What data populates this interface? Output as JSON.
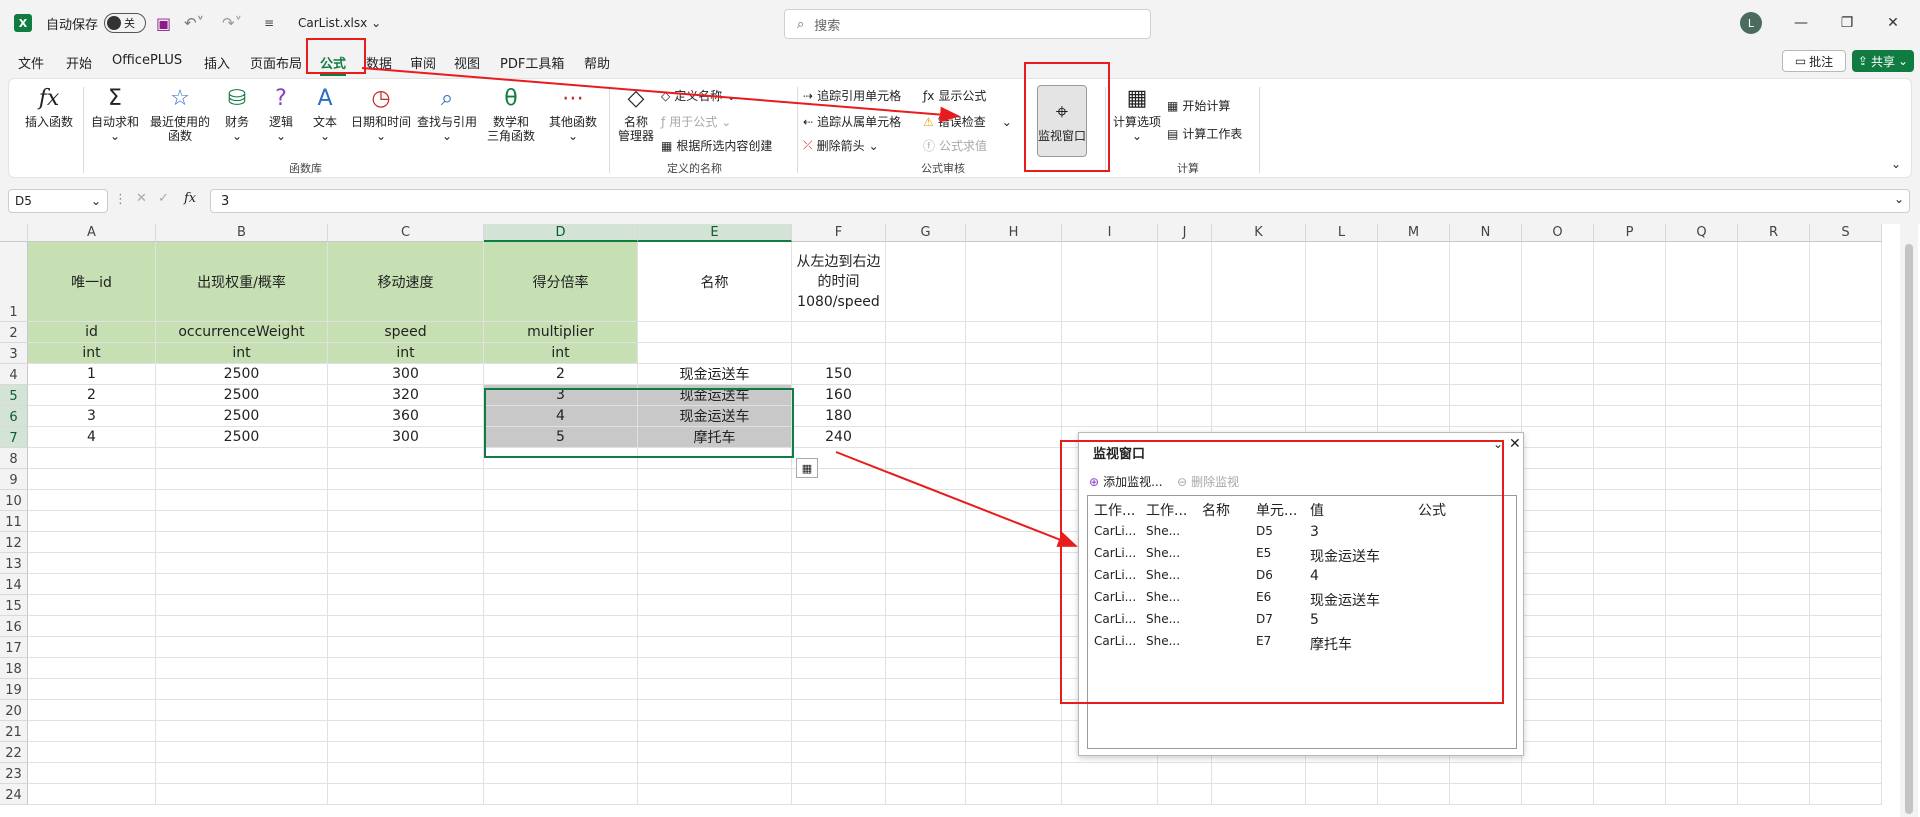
{
  "titlebar": {
    "app_icon": "X",
    "autosave_label": "自动保存",
    "autosave_state": "关",
    "filename": "CarList.xlsx",
    "search_placeholder": "搜索",
    "avatar_initial": "L"
  },
  "tabs": [
    "文件",
    "开始",
    "OfficePLUS",
    "插入",
    "页面布局",
    "公式",
    "数据",
    "审阅",
    "视图",
    "PDF工具箱",
    "帮助"
  ],
  "active_tab": "公式",
  "top_right": {
    "comments": "批注",
    "share": "共享"
  },
  "ribbon": {
    "function_library": {
      "label": "函数库",
      "buttons": [
        "插入函数",
        "自动求和",
        "最近使用的\n函数",
        "财务",
        "逻辑",
        "文本",
        "日期和时间",
        "查找与引用",
        "数学和\n三角函数",
        "其他函数"
      ]
    },
    "defined_names": {
      "label": "定义的名称",
      "manager": "名称\n管理器",
      "define": "定义名称",
      "use_in_formula": "用于公式",
      "create_from_selection": "根据所选内容创建"
    },
    "formula_auditing": {
      "label": "公式审核",
      "trace_precedents": "追踪引用单元格",
      "trace_dependents": "追踪从属单元格",
      "remove_arrows": "删除箭头",
      "show_formulas": "显示公式",
      "error_checking": "错误检查",
      "evaluate": "公式求值",
      "watch_window": "监视窗口"
    },
    "calculation": {
      "label": "计算",
      "options": "计算选项",
      "calc_now": "开始计算",
      "calc_sheet": "计算工作表"
    }
  },
  "formula_bar": {
    "name_box": "D5",
    "fx": "fx",
    "value": "3"
  },
  "columns": [
    "A",
    "B",
    "C",
    "D",
    "E",
    "F",
    "G",
    "H",
    "I",
    "J",
    "K",
    "L",
    "M",
    "N",
    "O",
    "P",
    "Q",
    "R",
    "S"
  ],
  "rows": [
    "1",
    "2",
    "3",
    "4",
    "5",
    "6",
    "7",
    "8",
    "9",
    "10",
    "11",
    "12",
    "13",
    "14",
    "15",
    "16",
    "17",
    "18",
    "19",
    "20",
    "21",
    "22",
    "23",
    "24"
  ],
  "sheet": {
    "row1": [
      "唯一id",
      "出现权重/概率",
      "移动速度",
      "得分倍率",
      "名称",
      "从左边到右边的时间1080/speed"
    ],
    "row2": [
      "id",
      "occurrenceWeight",
      "speed",
      "multiplier"
    ],
    "row3": [
      "int",
      "int",
      "int",
      "int"
    ],
    "data": [
      [
        "1",
        "2500",
        "300",
        "2",
        "现金运送车",
        "150"
      ],
      [
        "2",
        "2500",
        "320",
        "3",
        "现金运送车",
        "160"
      ],
      [
        "3",
        "2500",
        "360",
        "4",
        "现金运送车",
        "180"
      ],
      [
        "4",
        "2500",
        "300",
        "5",
        "摩托车",
        "240"
      ]
    ]
  },
  "watch_window": {
    "title": "监视窗口",
    "add": "添加监视...",
    "delete": "删除监视",
    "headers": [
      "工作...",
      "工作...",
      "名称",
      "单元...",
      "值",
      "公式"
    ],
    "rows": [
      [
        "CarLi...",
        "She...",
        "",
        "D5",
        "3",
        ""
      ],
      [
        "CarLi...",
        "She...",
        "",
        "E5",
        "现金运送车",
        ""
      ],
      [
        "CarLi...",
        "She...",
        "",
        "D6",
        "4",
        ""
      ],
      [
        "CarLi...",
        "She...",
        "",
        "E6",
        "现金运送车",
        ""
      ],
      [
        "CarLi...",
        "She...",
        "",
        "D7",
        "5",
        ""
      ],
      [
        "CarLi...",
        "She...",
        "",
        "E7",
        "摩托车",
        ""
      ]
    ]
  },
  "colors": {
    "accent": "#107c41",
    "header_fill": "#c6e0b4",
    "annotation": "#e81c1c"
  }
}
